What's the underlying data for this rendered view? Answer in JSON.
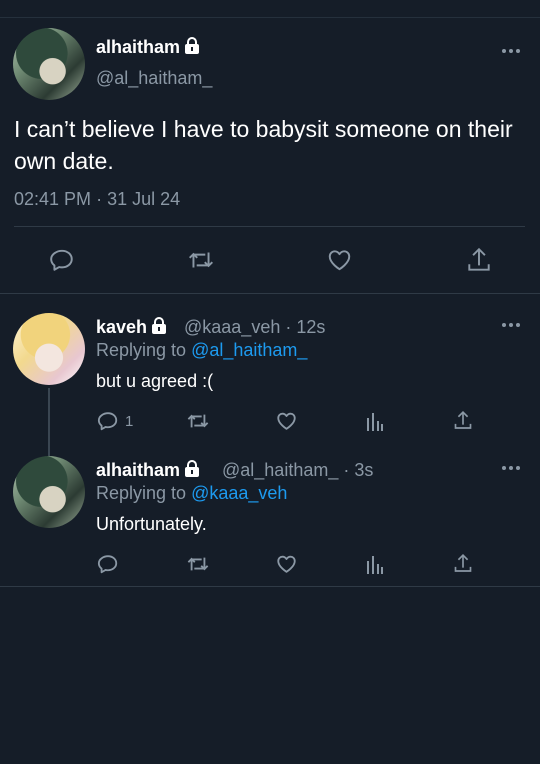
{
  "main_tweet": {
    "display_name": "alhaitham",
    "handle": "@al_haitham_",
    "text": "I can’t believe I have to babysit someone on their own date.",
    "time": "02:41 PM",
    "date_sep": "·",
    "date": "31 Jul 24",
    "actions": [
      "reply-icon",
      "retweet-icon",
      "like-icon",
      "share-icon"
    ]
  },
  "replies": [
    {
      "display_name": "kaveh",
      "handle": "@kaaa_veh",
      "sep": "·",
      "age": "12s",
      "replying_prefix": "Replying to",
      "replying_to": "@al_haitham_",
      "text": "but u agreed :(",
      "reply_count": "1"
    },
    {
      "display_name": "alhaitham",
      "handle": "@al_haitham_",
      "sep": "·",
      "age": "3s",
      "replying_prefix": "Replying to",
      "replying_to": "@kaaa_veh",
      "text": "Unfortunately.",
      "reply_count": ""
    }
  ],
  "colors": {
    "background": "#151d28",
    "text": "#ffffff",
    "muted": "#8b98a5",
    "link": "#1d9bf0",
    "divider": "#2f3a46"
  }
}
